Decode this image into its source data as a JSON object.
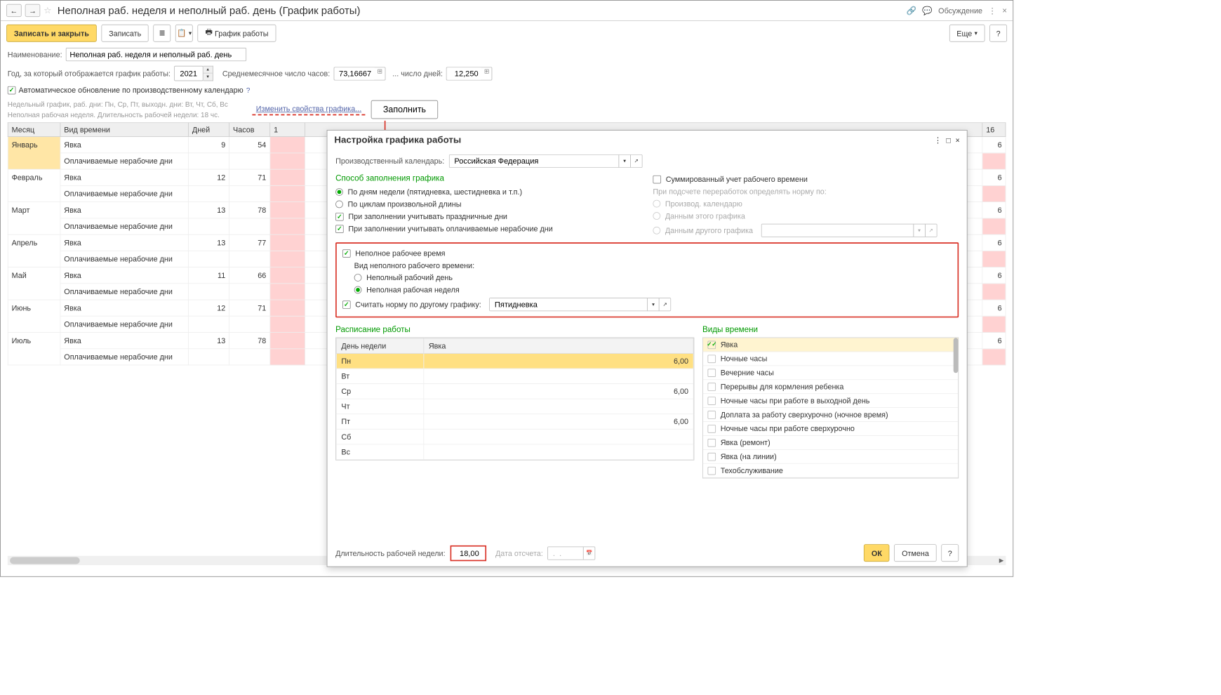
{
  "header": {
    "title": "Неполная раб. неделя и неполный раб. день (График работы)",
    "discussion": "Обсуждение"
  },
  "toolbar": {
    "save_close": "Записать и закрыть",
    "save": "Записать",
    "graph": "График работы",
    "more": "Еще"
  },
  "form": {
    "name_label": "Наименование:",
    "name_value": "Неполная раб. неделя и неполный раб. день",
    "year_label": "Год, за который отображается график работы:",
    "year_value": "2021",
    "avg_hours_label": "Среднемесячное число часов:",
    "avg_hours_value": "73,16667",
    "days_label": "... число дней:",
    "days_value": "12,250",
    "auto_update": "Автоматическое обновление по производственному календарю",
    "sub1": "Недельный график, раб. дни: Пн, Ср, Пт, выходн. дни: Вт, Чт, Сб, Вс",
    "sub2": "Неполная рабочая неделя. Длительность рабочей недели: 18 чс.",
    "change_props": "Изменить свойства графика...",
    "fill": "Заполнить"
  },
  "table": {
    "cols": {
      "month": "Месяц",
      "type": "Вид времени",
      "days": "Дней",
      "hours": "Часов",
      "c1": "1",
      "c16": "16"
    },
    "type_attend": "Явка",
    "type_paid": "Оплачиваемые нерабочие дни",
    "rows": [
      {
        "month": "Январь",
        "days": "9",
        "hours": "54",
        "yellow": true
      },
      {
        "month": "Февраль",
        "days": "12",
        "hours": "71"
      },
      {
        "month": "Март",
        "days": "13",
        "hours": "78"
      },
      {
        "month": "Апрель",
        "days": "13",
        "hours": "77"
      },
      {
        "month": "Май",
        "days": "11",
        "hours": "66"
      },
      {
        "month": "Июнь",
        "days": "12",
        "hours": "71"
      },
      {
        "month": "Июль",
        "days": "13",
        "hours": "78"
      }
    ]
  },
  "popup": {
    "title": "Настройка графика работы",
    "calendar_label": "Производственный календарь:",
    "calendar_value": "Российская Федерация",
    "fill_method": "Способ заполнения графика",
    "by_days": "По дням недели (пятидневка, шестидневка и т.п.)",
    "by_cycles": "По циклам произвольной длины",
    "holidays": "При заполнении учитывать праздничные дни",
    "paid_nonwork": "При заполнении учитывать оплачиваемые нерабочие дни",
    "summed": "Суммированный учет рабочего времени",
    "norm_label": "При подсчете переработок определять норму по:",
    "norm_cal": "Производ. календарю",
    "norm_this": "Данным этого графика",
    "norm_other": "Данным другого графика",
    "parttime": "Неполное рабочее время",
    "parttime_kind": "Вид неполного рабочего времени:",
    "partday": "Неполный рабочий день",
    "partweek": "Неполная рабочая неделя",
    "norm_other_graph": "Считать норму по другому графику:",
    "norm_other_value": "Пятидневка",
    "schedule": "Расписание работы",
    "col_day": "День недели",
    "col_attend": "Явка",
    "days": [
      "Пн",
      "Вт",
      "Ср",
      "Чт",
      "Пт",
      "Сб",
      "Вс"
    ],
    "vals": {
      "Пн": "6,00",
      "Ср": "6,00",
      "Пт": "6,00"
    },
    "time_types_title": "Виды времени",
    "time_types": [
      {
        "label": "Явка",
        "checked": true,
        "yellow": true
      },
      {
        "label": "Ночные часы"
      },
      {
        "label": "Вечерние часы"
      },
      {
        "label": "Перерывы для кормления ребенка"
      },
      {
        "label": "Ночные часы при работе в выходной день"
      },
      {
        "label": "Доплата за работу сверхурочно (ночное время)"
      },
      {
        "label": "Ночные часы при работе сверхурочно"
      },
      {
        "label": "Явка (ремонт)"
      },
      {
        "label": "Явка (на линии)"
      },
      {
        "label": "Техобслуживание"
      }
    ],
    "week_len_label": "Длительность рабочей недели:",
    "week_len_value": "18,00",
    "date_label": "Дата отсчета:",
    "date_value": ".  .",
    "ok": "ОК",
    "cancel": "Отмена"
  }
}
